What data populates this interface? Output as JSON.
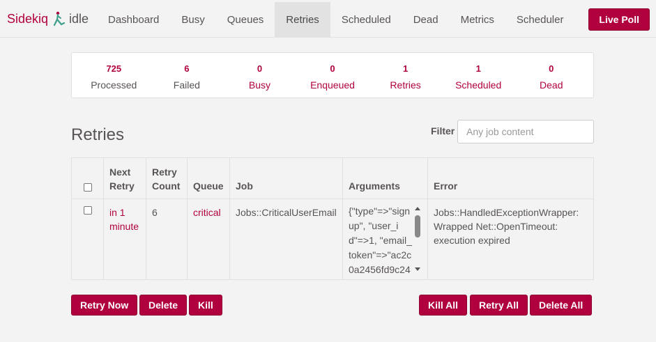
{
  "brand": {
    "name": "Sidekiq",
    "status": "idle",
    "logo_icon": "sidekiq-logo-icon"
  },
  "nav": {
    "items": [
      {
        "label": "Dashboard",
        "active": false
      },
      {
        "label": "Busy",
        "active": false
      },
      {
        "label": "Queues",
        "active": false
      },
      {
        "label": "Retries",
        "active": true
      },
      {
        "label": "Scheduled",
        "active": false
      },
      {
        "label": "Dead",
        "active": false
      },
      {
        "label": "Metrics",
        "active": false
      },
      {
        "label": "Scheduler",
        "active": false
      }
    ],
    "live_poll_label": "Live Poll"
  },
  "stats": [
    {
      "value": "725",
      "label": "Processed"
    },
    {
      "value": "6",
      "label": "Failed"
    },
    {
      "value": "0",
      "label": "Busy"
    },
    {
      "value": "0",
      "label": "Enqueued"
    },
    {
      "value": "1",
      "label": "Retries"
    },
    {
      "value": "1",
      "label": "Scheduled"
    },
    {
      "value": "0",
      "label": "Dead"
    }
  ],
  "page": {
    "title": "Retries",
    "filter_label": "Filter",
    "filter_placeholder": "Any job content",
    "filter_value": ""
  },
  "table": {
    "headers": {
      "next_retry_1": "Next",
      "next_retry_2": "Retry",
      "retry_count_1": "Retry",
      "retry_count_2": "Count",
      "queue": "Queue",
      "job": "Job",
      "arguments": "Arguments",
      "error": "Error"
    },
    "rows": [
      {
        "next_retry": "in 1 minute",
        "retry_count": "6",
        "queue": "critical",
        "job": "Jobs::CriticalUserEmail",
        "arguments": "{\"type\"=>\"signup\", \"user_id\"=>1, \"email_token\"=>\"ac2c0a2456fd9c24",
        "error": "Jobs::HandledExceptionWrapper: Wrapped Net::OpenTimeout: execution expired"
      }
    ]
  },
  "buttons": {
    "retry_now": "Retry Now",
    "delete": "Delete",
    "kill": "Kill",
    "kill_all": "Kill All",
    "retry_all": "Retry All",
    "delete_all": "Delete All"
  },
  "colors": {
    "accent": "#b1003e",
    "background": "#f3f3f3",
    "text": "#585454"
  }
}
